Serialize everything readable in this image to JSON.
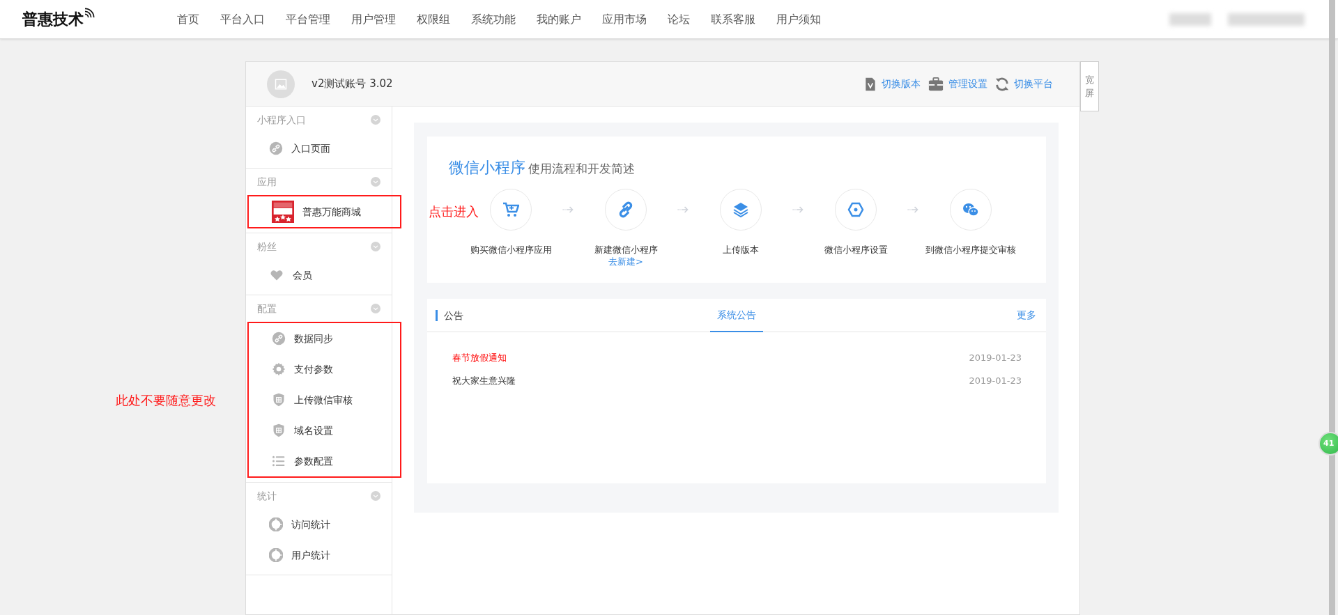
{
  "navbar": {
    "logo": "普惠技术",
    "items": [
      {
        "label": "首页"
      },
      {
        "label": "平台入口"
      },
      {
        "label": "平台管理"
      },
      {
        "label": "用户管理"
      },
      {
        "label": "权限组"
      },
      {
        "label": "系统功能"
      },
      {
        "label": "我的账户"
      },
      {
        "label": "应用市场"
      },
      {
        "label": "论坛"
      },
      {
        "label": "联系客服"
      },
      {
        "label": "用户须知"
      }
    ]
  },
  "account": {
    "name": "v2测试账号 3.02",
    "actions": [
      {
        "label": "切换版本",
        "kind": "version"
      },
      {
        "label": "管理设置",
        "kind": "briefcase"
      },
      {
        "label": "切换平台",
        "kind": "refresh"
      }
    ]
  },
  "wide_screen_button": "宽屏",
  "sidebar": {
    "sections": [
      {
        "title": "小程序入口",
        "outlined": false,
        "items": [
          {
            "label": "入口页面",
            "kind": "link"
          }
        ]
      },
      {
        "title": "应用",
        "outlined": true,
        "items": [
          {
            "label": "普惠万能商城",
            "kind": "shop"
          }
        ]
      },
      {
        "title": "粉丝",
        "outlined": false,
        "items": [
          {
            "label": "会员",
            "kind": "heart"
          }
        ]
      },
      {
        "title": "配置",
        "outlined": true,
        "items": [
          {
            "label": "数据同步",
            "kind": "link"
          },
          {
            "label": "支付参数",
            "kind": "gear"
          },
          {
            "label": "上传微信审核",
            "kind": "shield"
          },
          {
            "label": "域名设置",
            "kind": "shield"
          },
          {
            "label": "参数配置",
            "kind": "list"
          }
        ]
      },
      {
        "title": "统计",
        "outlined": false,
        "items": [
          {
            "label": "访问统计",
            "kind": "pie"
          },
          {
            "label": "用户统计",
            "kind": "pie"
          }
        ]
      }
    ]
  },
  "flow": {
    "title_highlight": "微信小程序",
    "title_rest": "使用流程和开发简述",
    "steps": [
      {
        "label": "购买微信小程序应用",
        "kind": "cart"
      },
      {
        "label": "新建微信小程序",
        "link": "去新建>",
        "kind": "link"
      },
      {
        "label": "上传版本",
        "kind": "layers"
      },
      {
        "label": "微信小程序设置",
        "kind": "hexagon"
      },
      {
        "label": "到微信小程序提交审核",
        "kind": "wechat"
      }
    ]
  },
  "notices": {
    "title": "公告",
    "tabs": [
      {
        "label": "系统公告",
        "selected": true
      }
    ],
    "more": "更多",
    "items": [
      {
        "title": "春节放假通知",
        "date": "2019-01-23",
        "highlighted": true
      },
      {
        "title": "祝大家生意兴隆",
        "date": "2019-01-23",
        "highlighted": false
      }
    ]
  },
  "annotations": [
    {
      "text": "点击进入"
    },
    {
      "text": "此处不要随意更改"
    }
  ],
  "floating_badge": "41"
}
